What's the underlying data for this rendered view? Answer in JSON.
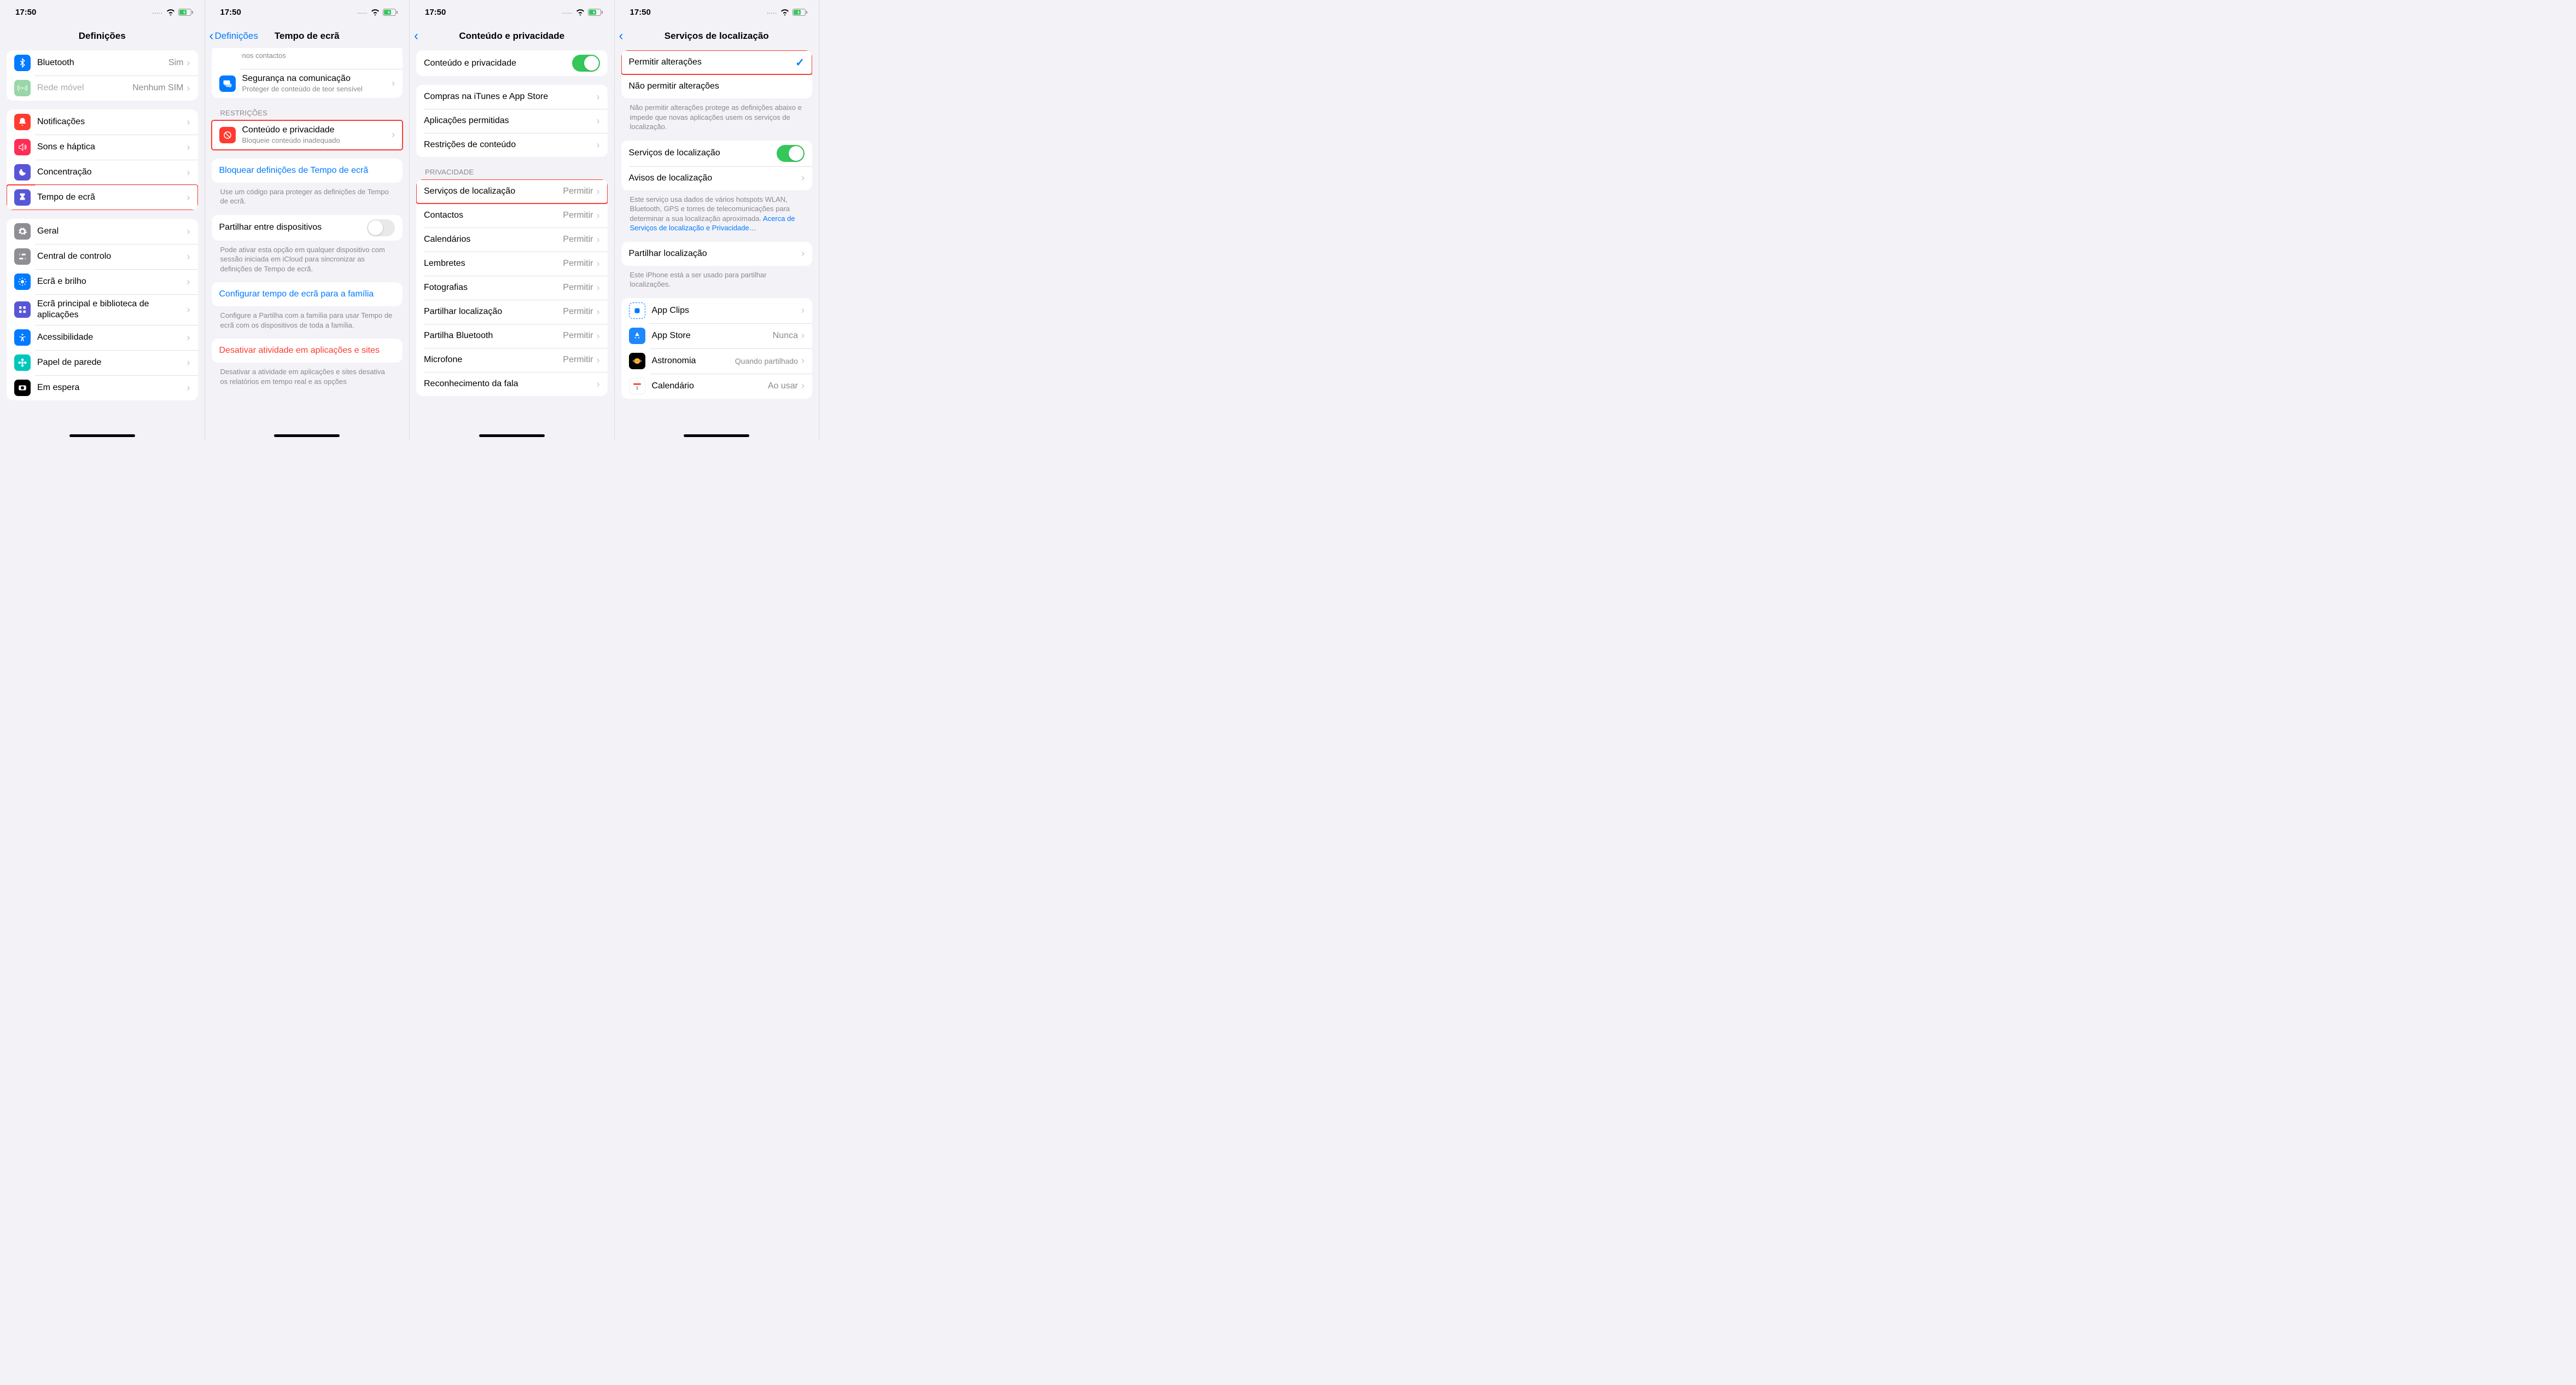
{
  "status": {
    "time": "17:50",
    "dots": "....."
  },
  "s1": {
    "title": "Definições",
    "rows": {
      "bluetooth": {
        "label": "Bluetooth",
        "value": "Sim"
      },
      "mobile": {
        "label": "Rede móvel",
        "value": "Nenhum SIM"
      },
      "notif": {
        "label": "Notificações"
      },
      "sounds": {
        "label": "Sons e háptica"
      },
      "focus": {
        "label": "Concentração"
      },
      "screentime": {
        "label": "Tempo de ecrã"
      },
      "general": {
        "label": "Geral"
      },
      "cc": {
        "label": "Central de controlo"
      },
      "display": {
        "label": "Ecrã e brilho"
      },
      "home": {
        "label": "Ecrã principal e biblioteca de aplicações"
      },
      "access": {
        "label": "Acessibilidade"
      },
      "wall": {
        "label": "Papel de parede"
      },
      "standby": {
        "label": "Em espera"
      }
    }
  },
  "s2": {
    "back": "Definições",
    "title": "Tempo de ecrã",
    "safety_partial": "nos contactos",
    "safety": {
      "label": "Segurança na comunicação",
      "sub": "Proteger de conteúdo de teor sensível"
    },
    "section_restr": "RESTRIÇÕES",
    "content": {
      "label": "Conteúdo e privacidade",
      "sub": "Bloqueie conteúdo inadequado"
    },
    "lock": {
      "label": "Bloquear definições de Tempo de ecrã",
      "foot": "Use um código para proteger as definições de Tempo de ecrã."
    },
    "share": {
      "label": "Partilhar entre dispositivos",
      "foot": "Pode ativar esta opção em qualquer dispositivo com sessão iniciada em iCloud para sincronizar as definições de Tempo de ecrã."
    },
    "family": {
      "label": "Configurar tempo de ecrã para a família",
      "foot": "Configure a Partilha com a família para usar Tempo de ecrã com os dispositivos de toda a família."
    },
    "disable": {
      "label": "Desativar atividade em aplicações e sites",
      "foot": "Desativar a atividade em aplicações e sites desativa os relatórios em tempo real e as opções"
    }
  },
  "s3": {
    "title": "Conteúdo e privacidade",
    "main_toggle": "Conteúdo e privacidade",
    "itunes": "Compras na iTunes e App Store",
    "allowed": "Aplicações permitidas",
    "restr": "Restrições de conteúdo",
    "section_priv": "PRIVACIDADE",
    "permit": "Permitir",
    "loc": "Serviços de localização",
    "contacts": "Contactos",
    "cal": "Calendários",
    "rem": "Lembretes",
    "photos": "Fotografias",
    "shareloc": "Partilhar localização",
    "bt": "Partilha Bluetooth",
    "mic": "Microfone",
    "speech": "Reconhecimento da fala"
  },
  "s4": {
    "title": "Serviços de localização",
    "allow_changes": "Permitir alterações",
    "deny_changes": "Não permitir alterações",
    "foot1": "Não permitir alterações protege as definições abaixo e impede que novas aplicações usem os serviços de localização.",
    "loc_services": "Serviços de localização",
    "loc_alerts": "Avisos de localização",
    "foot2_a": "Este serviço usa dados de vários hotspots WLAN, Bluetooth, GPS e torres de telecomunicações para determinar a sua localização aproximada. ",
    "foot2_b": "Acerca de Serviços de localização e Privacidade…",
    "share_my_loc": "Partilhar localização",
    "foot3": "Este iPhone está a ser usado para partilhar localizações.",
    "app_clips": "App Clips",
    "app_store": {
      "label": "App Store",
      "value": "Nunca"
    },
    "astro": {
      "label": "Astronomia",
      "value": "Quando partilhado"
    },
    "cal": {
      "label": "Calendário",
      "value": "Ao usar"
    }
  }
}
